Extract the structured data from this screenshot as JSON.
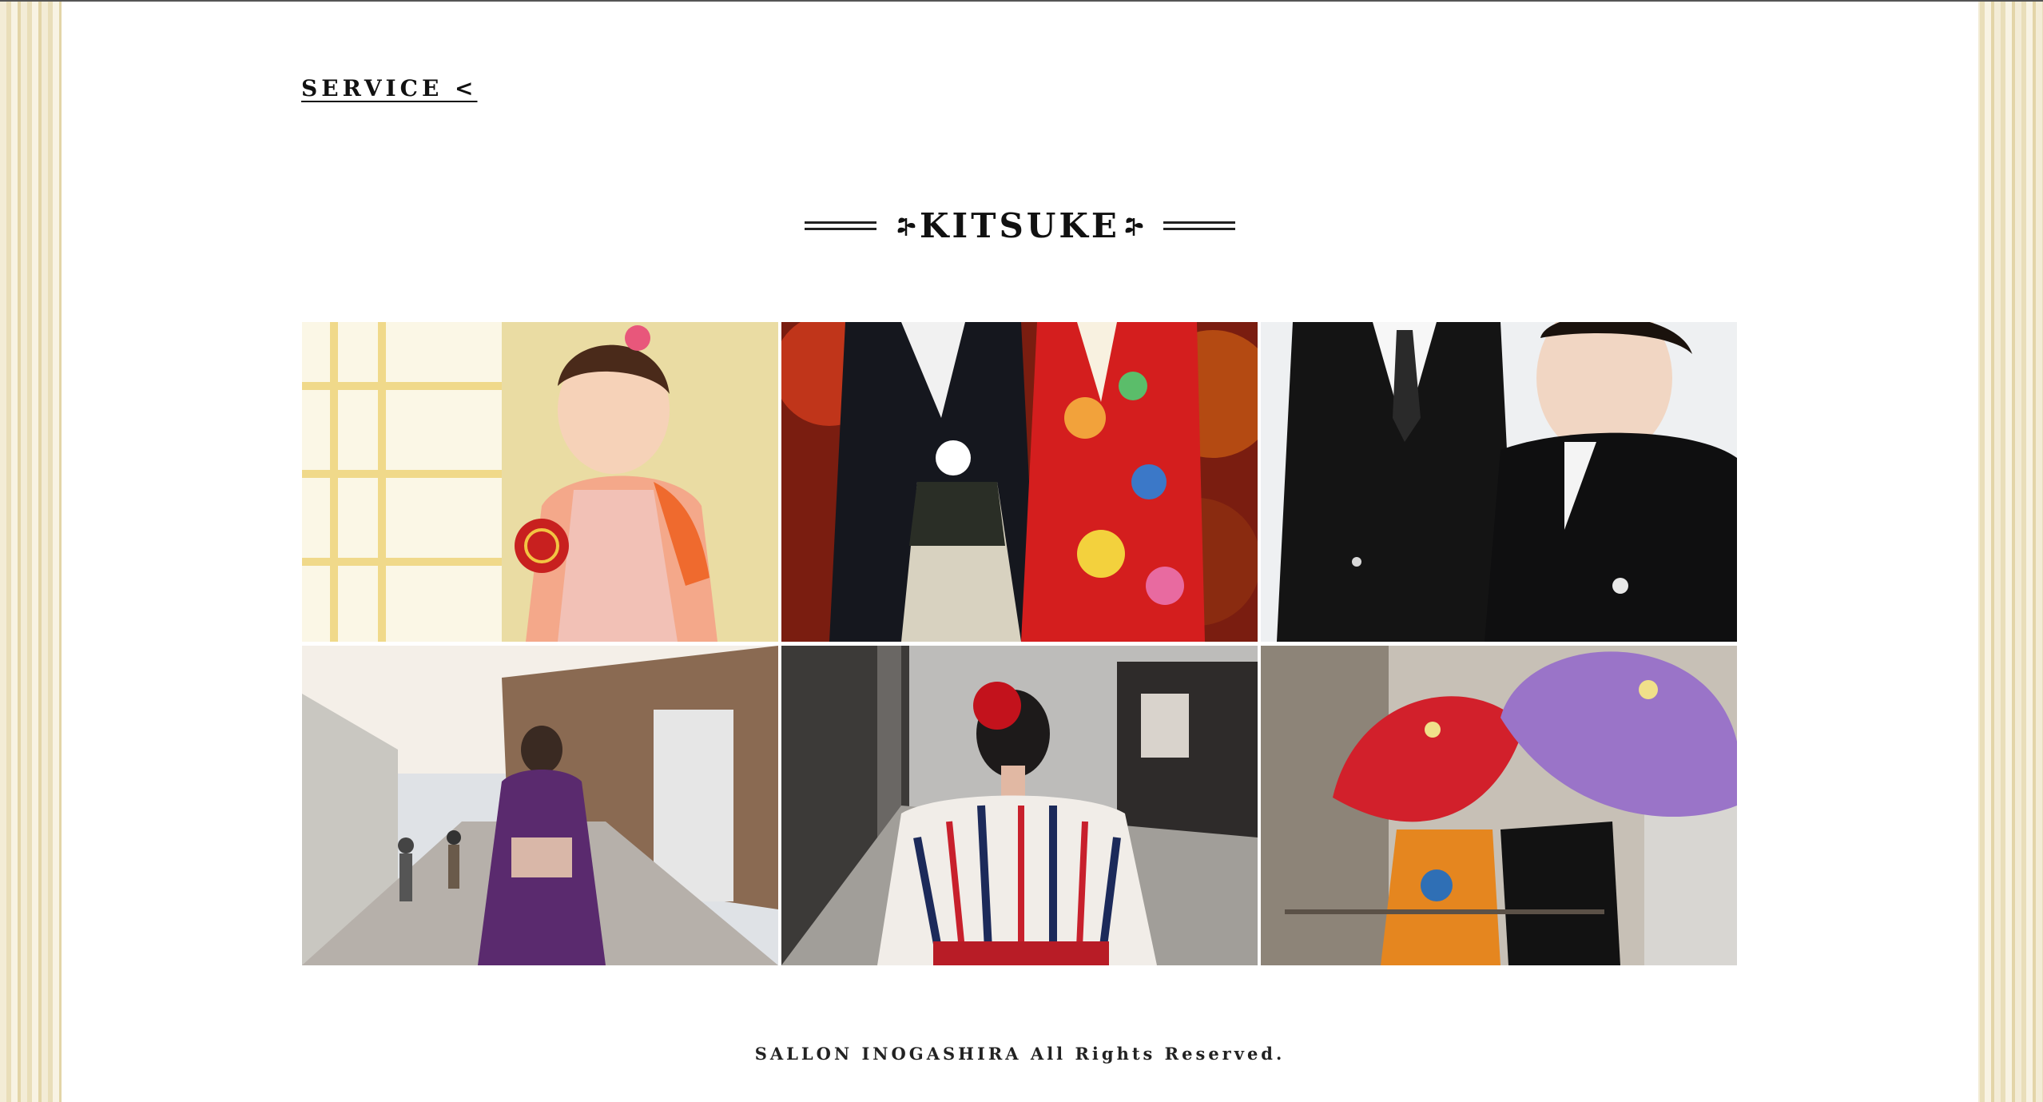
{
  "nav": {
    "service_link": "SERVICE <"
  },
  "section": {
    "title": "KITSUKE"
  },
  "gallery": {
    "photos": [
      {
        "subject": "girl-kimono-temari"
      },
      {
        "subject": "couple-wedding-kimono-autumn"
      },
      {
        "subject": "couple-black-formal"
      },
      {
        "subject": "woman-purple-kimono-street"
      },
      {
        "subject": "woman-striped-yukata-red-flower"
      },
      {
        "subject": "red-and-purple-wagasa-umbrellas"
      }
    ]
  },
  "footer": {
    "copyright": "SALLON INOGASHIRA All Rights Reserved."
  },
  "colors": {
    "background_stripe": "#e9deb9",
    "panel": "#ffffff",
    "text": "#111111"
  }
}
